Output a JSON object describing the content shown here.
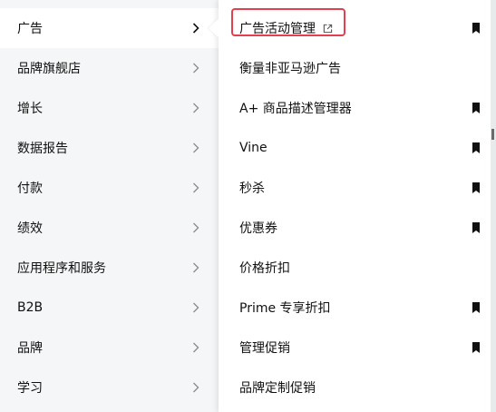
{
  "left_menu": {
    "items": [
      {
        "label": "广告",
        "active": true
      },
      {
        "label": "品牌旗舰店"
      },
      {
        "label": "增长"
      },
      {
        "label": "数据报告"
      },
      {
        "label": "付款"
      },
      {
        "label": "绩效"
      },
      {
        "label": "应用程序和服务"
      },
      {
        "label": "B2B"
      },
      {
        "label": "品牌"
      },
      {
        "label": "学习"
      }
    ],
    "chevron_icon": "chevron-right-icon"
  },
  "right_menu": {
    "items": [
      {
        "label": "广告活动管理",
        "external": true,
        "bookmarked": true,
        "highlighted": true
      },
      {
        "label": "衡量非亚马逊广告",
        "bookmarked": false
      },
      {
        "label": "A+ 商品描述管理器",
        "bookmarked": true
      },
      {
        "label": "Vine",
        "bookmarked": true
      },
      {
        "label": "秒杀",
        "bookmarked": true
      },
      {
        "label": "优惠券",
        "bookmarked": true
      },
      {
        "label": "价格折扣",
        "bookmarked": false
      },
      {
        "label": "Prime 专享折扣",
        "bookmarked": true
      },
      {
        "label": "管理促销",
        "bookmarked": true
      },
      {
        "label": "品牌定制促销",
        "bookmarked": false
      }
    ],
    "external_icon": "external-link-icon",
    "bookmark_icon": "bookmark-icon"
  },
  "colors": {
    "left_panel_bg": "#f4f6f7",
    "highlight_border": "#e23f4f",
    "text": "#111111",
    "icon": "#111111"
  }
}
